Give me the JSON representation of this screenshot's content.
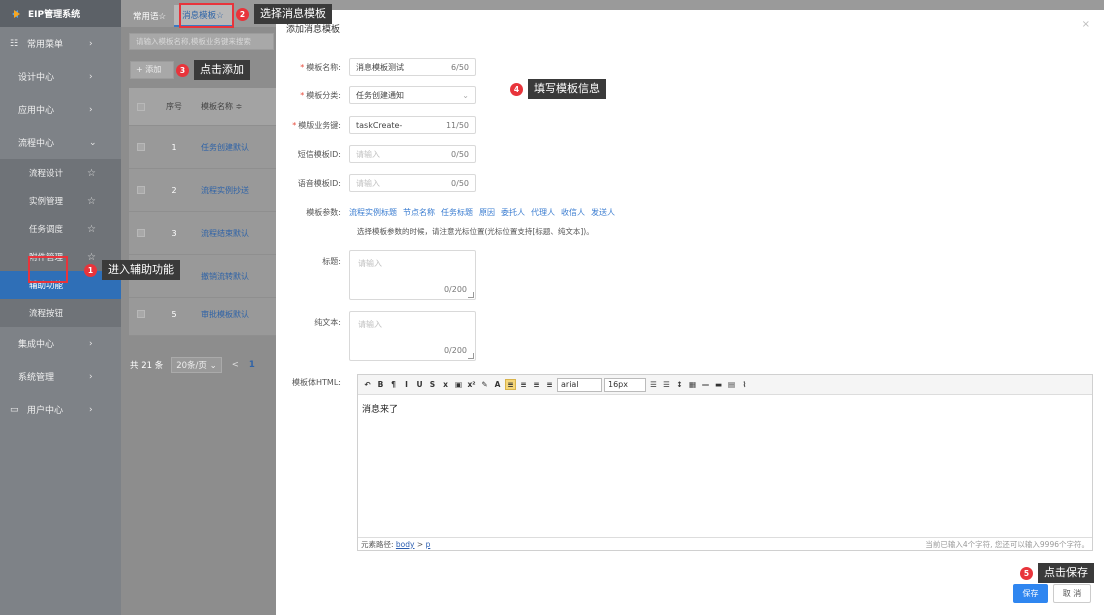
{
  "sidebar": {
    "app_title": "EIP管理系统",
    "items": [
      {
        "label": "常用菜单",
        "icon": "grid-icon"
      },
      {
        "label": "设计中心"
      },
      {
        "label": "应用中心"
      },
      {
        "label": "流程中心",
        "expanded": true
      },
      {
        "label": "集成中心"
      },
      {
        "label": "系统管理"
      },
      {
        "label": "用户中心",
        "icon": "monitor-icon"
      }
    ],
    "sub_items": [
      "流程设计",
      "实例管理",
      "任务调度",
      "附件管理",
      "辅助功能",
      "流程按钮"
    ],
    "active_sub": "辅助功能"
  },
  "tabs": [
    "常用语☆",
    "消息模板☆"
  ],
  "bg": {
    "search_placeholder": "请输入模板名称,模板业务键来搜索",
    "add_label": "+ 添加",
    "header_no": "序号",
    "header_name": "模板名称 ≑",
    "rows": [
      {
        "no": "1",
        "name": "任务创建默认"
      },
      {
        "no": "2",
        "name": "流程实例抄送"
      },
      {
        "no": "3",
        "name": "流程结束默认"
      },
      {
        "no": "4",
        "name": "撤销流转默认"
      },
      {
        "no": "5",
        "name": "审批模板默认"
      }
    ],
    "total": "共 21 条",
    "page_size": "20条/页 ⌄",
    "prev": "<",
    "current_page": "1"
  },
  "callouts": {
    "c1": {
      "num": "1",
      "text": "进入辅助功能"
    },
    "c2": {
      "num": "2",
      "text": "选择消息模板"
    },
    "c3": {
      "num": "3",
      "text": "点击添加"
    },
    "c4": {
      "num": "4",
      "text": "填写模板信息"
    },
    "c5": {
      "num": "5",
      "text": "点击保存"
    }
  },
  "dialog": {
    "title": "添加消息模板",
    "close": "×",
    "fields": {
      "name": {
        "label": "模板名称:",
        "value": "消息模板测试",
        "count": "6/50"
      },
      "category": {
        "label": "模板分类:",
        "value": "任务创建通知"
      },
      "key": {
        "label": "模版业务键:",
        "value": "taskCreate-",
        "count": "11/50"
      },
      "sms": {
        "label": "短信模板ID:",
        "placeholder": "请输入",
        "count": "0/50"
      },
      "voice": {
        "label": "语音模板ID:",
        "placeholder": "请输入",
        "count": "0/50"
      },
      "params": {
        "label": "模板参数:",
        "items": [
          "流程实例标题",
          "节点名称",
          "任务标题",
          "原因",
          "委托人",
          "代理人",
          "收信人",
          "发送人"
        ]
      },
      "hint": "选择模板参数的时候，请注意光标位置(光标位置支持[标题、纯文本])。",
      "title": {
        "label": "标题:",
        "placeholder": "请输入",
        "count": "0/200"
      },
      "text": {
        "label": "纯文本:",
        "placeholder": "请输入",
        "count": "0/200"
      },
      "html": {
        "label": "模板体HTML:",
        "content": "消息来了"
      }
    },
    "editor": {
      "font": "arial",
      "size": "16px",
      "path_label": "元素路径:",
      "path_body": "body",
      "path_sep": ">",
      "path_p": "p",
      "count_text": "当前已输入4个字符, 您还可以输入9996个字符。"
    },
    "save": "保存",
    "cancel": "取 消"
  }
}
